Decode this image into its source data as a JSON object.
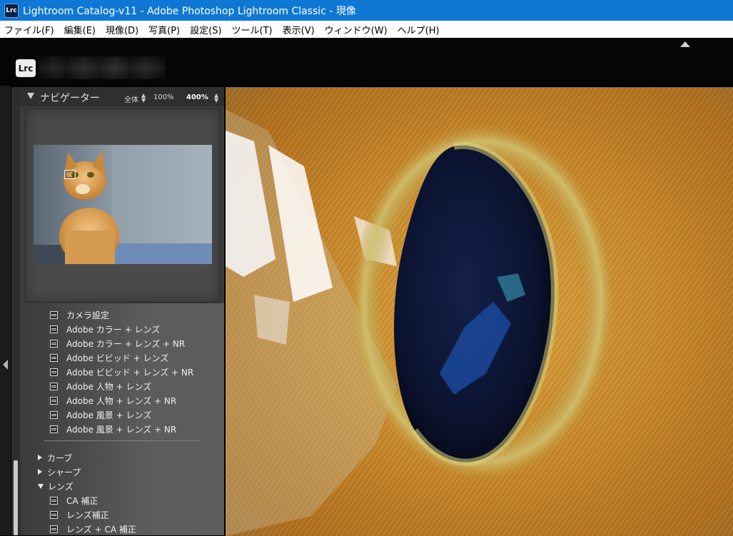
{
  "window": {
    "title": "Lightroom Catalog-v11 - Adobe Photoshop Lightroom Classic - 現像",
    "app_badge": "Lrc"
  },
  "menu": [
    "ファイル(F)",
    "編集(E)",
    "現像(D)",
    "写真(P)",
    "設定(S)",
    "ツール(T)",
    "表示(V)",
    "ウィンドウ(W)",
    "ヘルプ(H)"
  ],
  "logo": "Lrc",
  "navigator": {
    "title": "ナビゲーター",
    "zoom_options": [
      "全体",
      "100%",
      "400%"
    ],
    "active_zoom": "400%"
  },
  "presets": [
    "カメラ設定",
    "Adobe カラー + レンズ",
    "Adobe カラー + レンズ + NR",
    "Adobe ビビッド + レンズ",
    "Adobe ビビッド + レンズ + NR",
    "Adobe 人物 + レンズ",
    "Adobe 人物 + レンズ + NR",
    "Adobe 風景 + レンズ",
    "Adobe 風景 + レンズ + NR"
  ],
  "groups": {
    "curve": "カーブ",
    "sharpen": "シャープ",
    "lens": "レンズ",
    "lens_items": [
      "CA 補正",
      "レンズ補正",
      "レンズ + CA 補正"
    ]
  },
  "colors": {
    "titlebar": "#0f78d4",
    "panel": "#3b3b3b",
    "iris": "#c78a2a",
    "pupil": "#0c1430"
  }
}
